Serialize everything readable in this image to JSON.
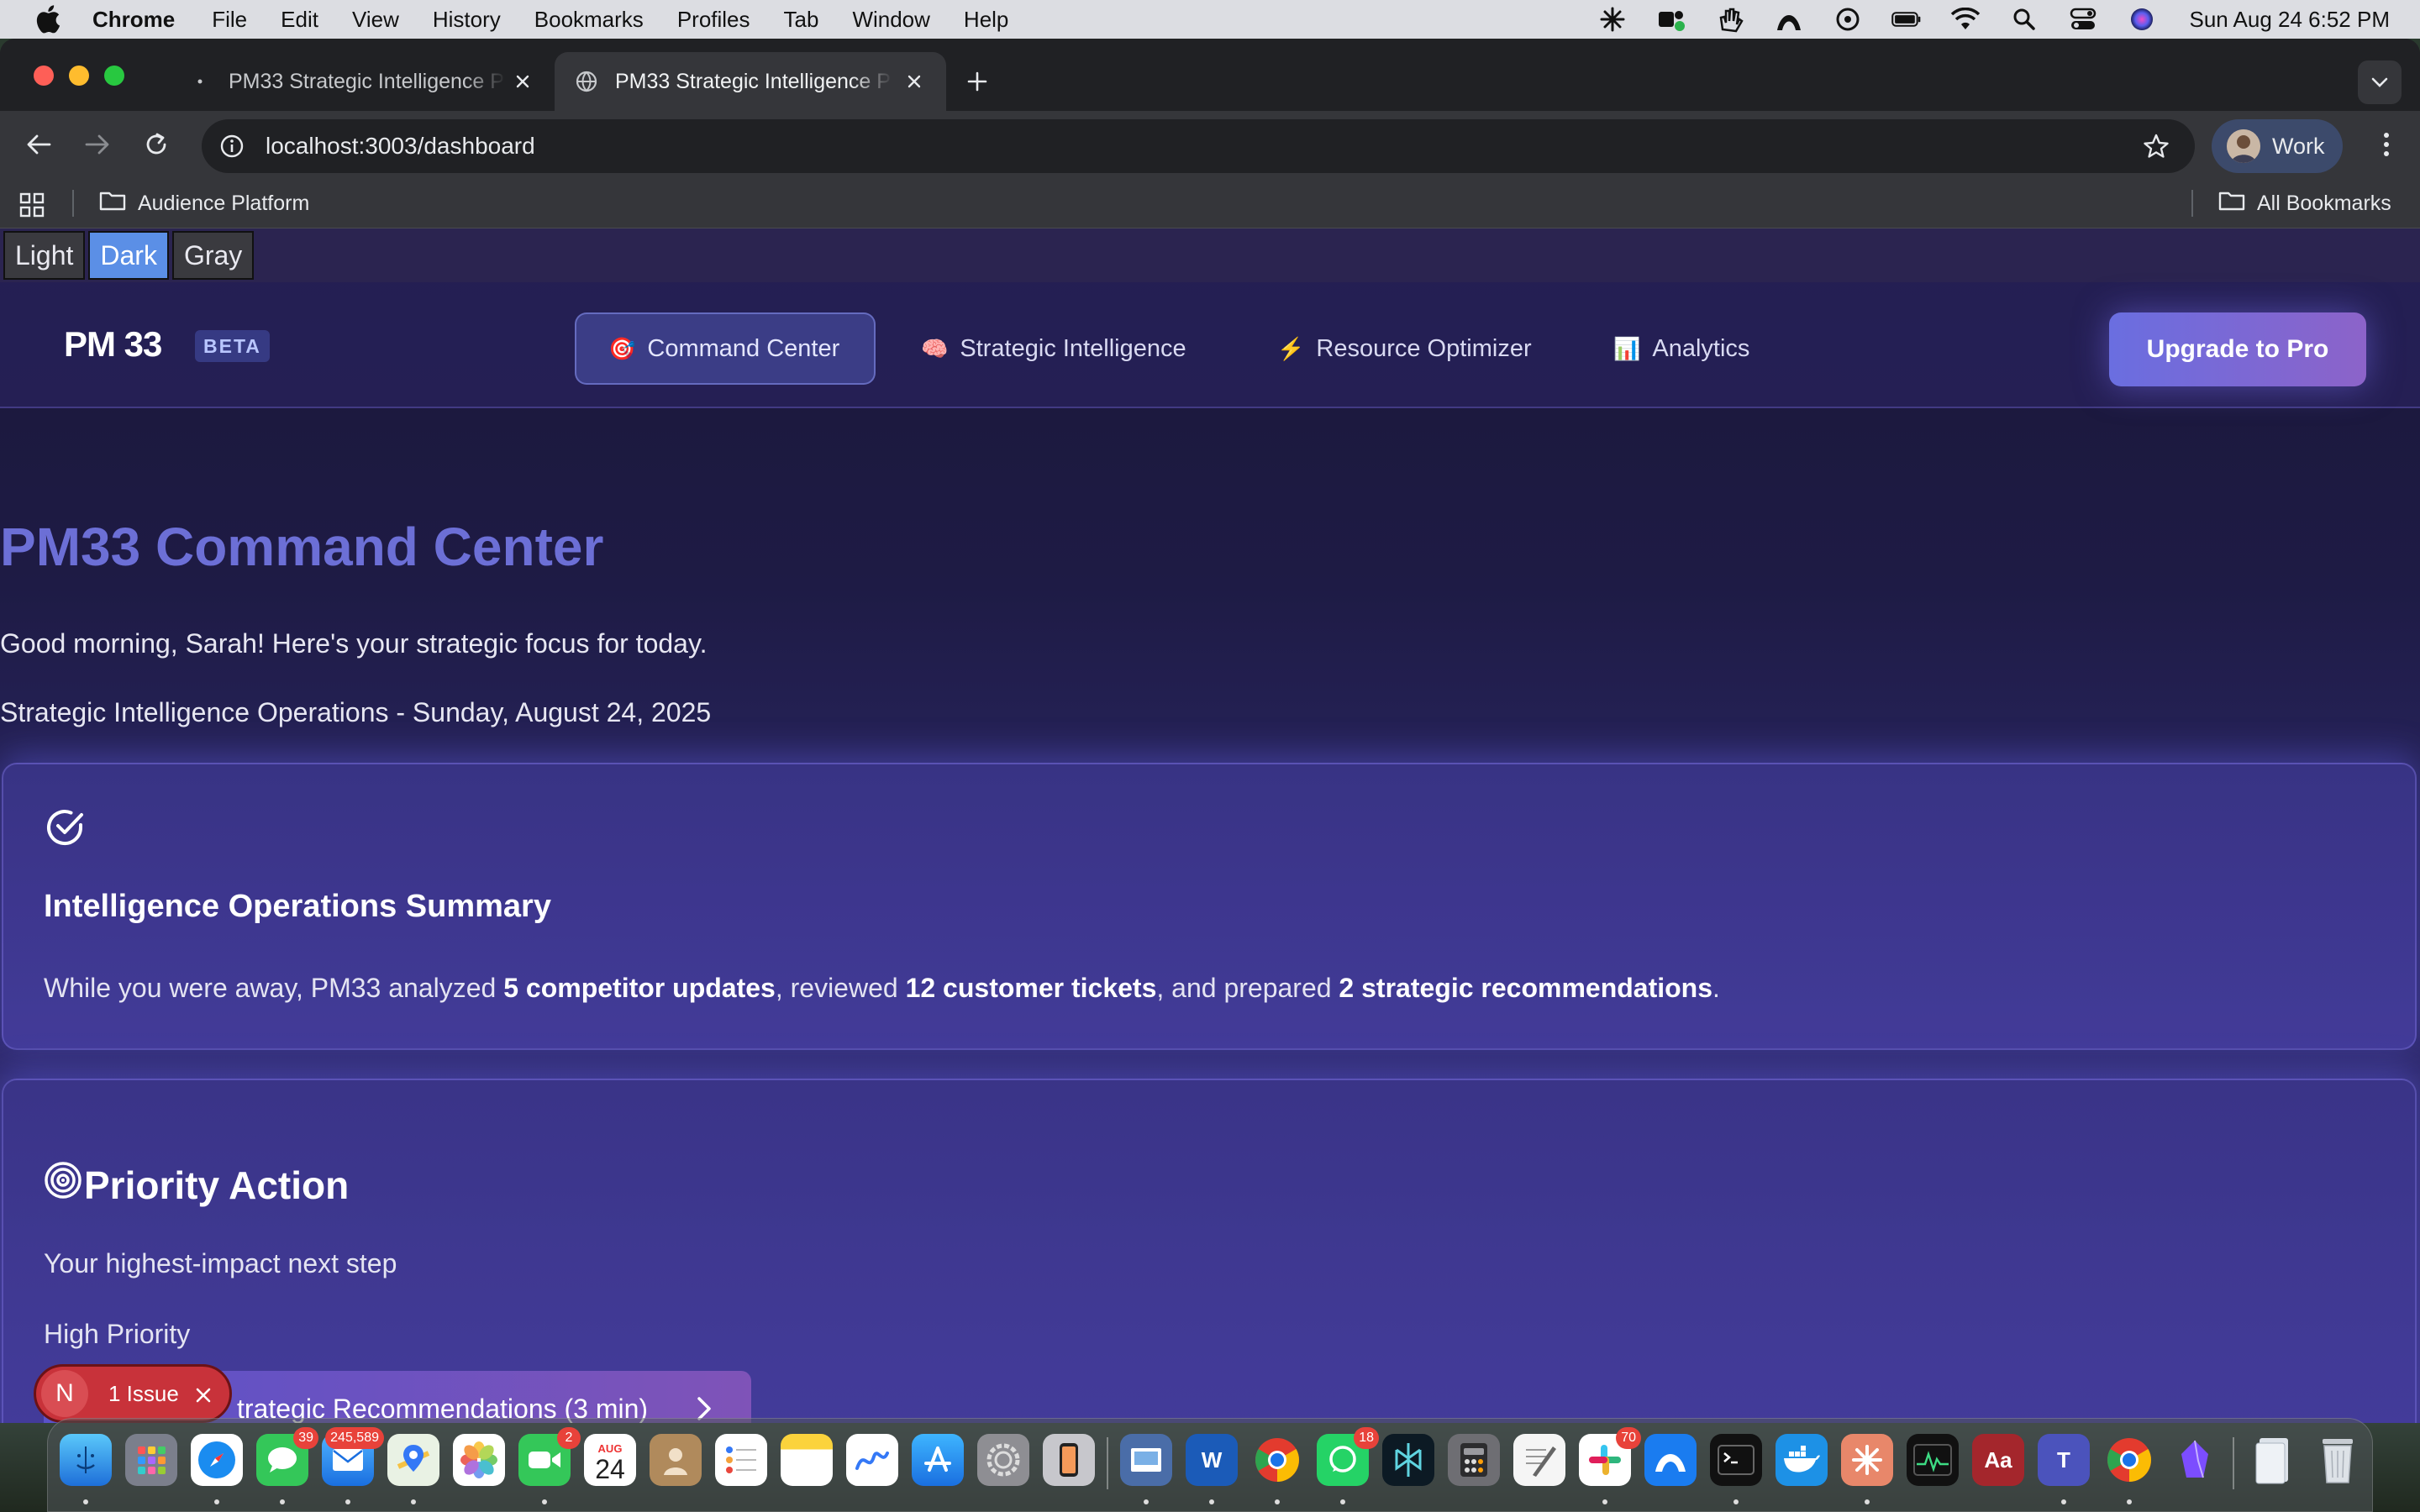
{
  "menubar": {
    "app_name": "Chrome",
    "items": [
      "File",
      "Edit",
      "View",
      "History",
      "Bookmarks",
      "Profiles",
      "Tab",
      "Window",
      "Help"
    ],
    "clock": "Sun Aug 24  6:52 PM"
  },
  "browser": {
    "tabs": [
      {
        "title": "PM33 Strategic Intelligence P",
        "active": false
      },
      {
        "title": "PM33 Strategic Intelligence P",
        "active": true
      }
    ],
    "url": "localhost:3003/dashboard",
    "profile_label": "Work",
    "bookmarks": {
      "folder": "Audience Platform",
      "all": "All Bookmarks"
    }
  },
  "theme_switcher": {
    "options": [
      "Light",
      "Dark",
      "Gray"
    ],
    "selected": "Dark"
  },
  "app_nav": {
    "logo": "PM 33",
    "badge": "BETA",
    "links": [
      {
        "icon": "🎯",
        "label": "Command Center",
        "active": true
      },
      {
        "icon": "🧠",
        "label": "Strategic Intelligence",
        "active": false
      },
      {
        "icon": "⚡",
        "label": "Resource Optimizer",
        "active": false
      },
      {
        "icon": "📊",
        "label": "Analytics",
        "active": false
      }
    ],
    "upgrade_label": "Upgrade to Pro"
  },
  "dashboard": {
    "title": "PM33 Command Center",
    "greeting": "Good morning, Sarah! Here's your strategic focus for today.",
    "subline": "Strategic Intelligence Operations - Sunday, August 24, 2025",
    "summary": {
      "title": "Intelligence Operations Summary",
      "prefix": "While you were away, PM33 analyzed ",
      "stat1": "5 competitor updates",
      "mid1": ", reviewed ",
      "stat2": "12 customer tickets",
      "mid2": ", and prepared ",
      "stat3": "2 strategic recommendations",
      "suffix": "."
    },
    "priority": {
      "title": "Priority Action",
      "subtitle": "Your highest-impact next step",
      "level": "High Priority",
      "action_label": "trategic Recommendations (3 min)"
    }
  },
  "dev_overlay": {
    "avatar_letter": "N",
    "label": "1 Issue"
  },
  "dock": {
    "badges": {
      "messages": "39",
      "mail": "245,589",
      "facetime": "2",
      "calendar_day": "24",
      "calendar_month": "AUG",
      "whatsapp": "18",
      "slack": "70"
    }
  },
  "colors": {
    "heading": "#6c6fd6",
    "upgrade_start": "#6a6ee0",
    "upgrade_end": "#8c63c9",
    "issue_red": "#c8323a"
  }
}
